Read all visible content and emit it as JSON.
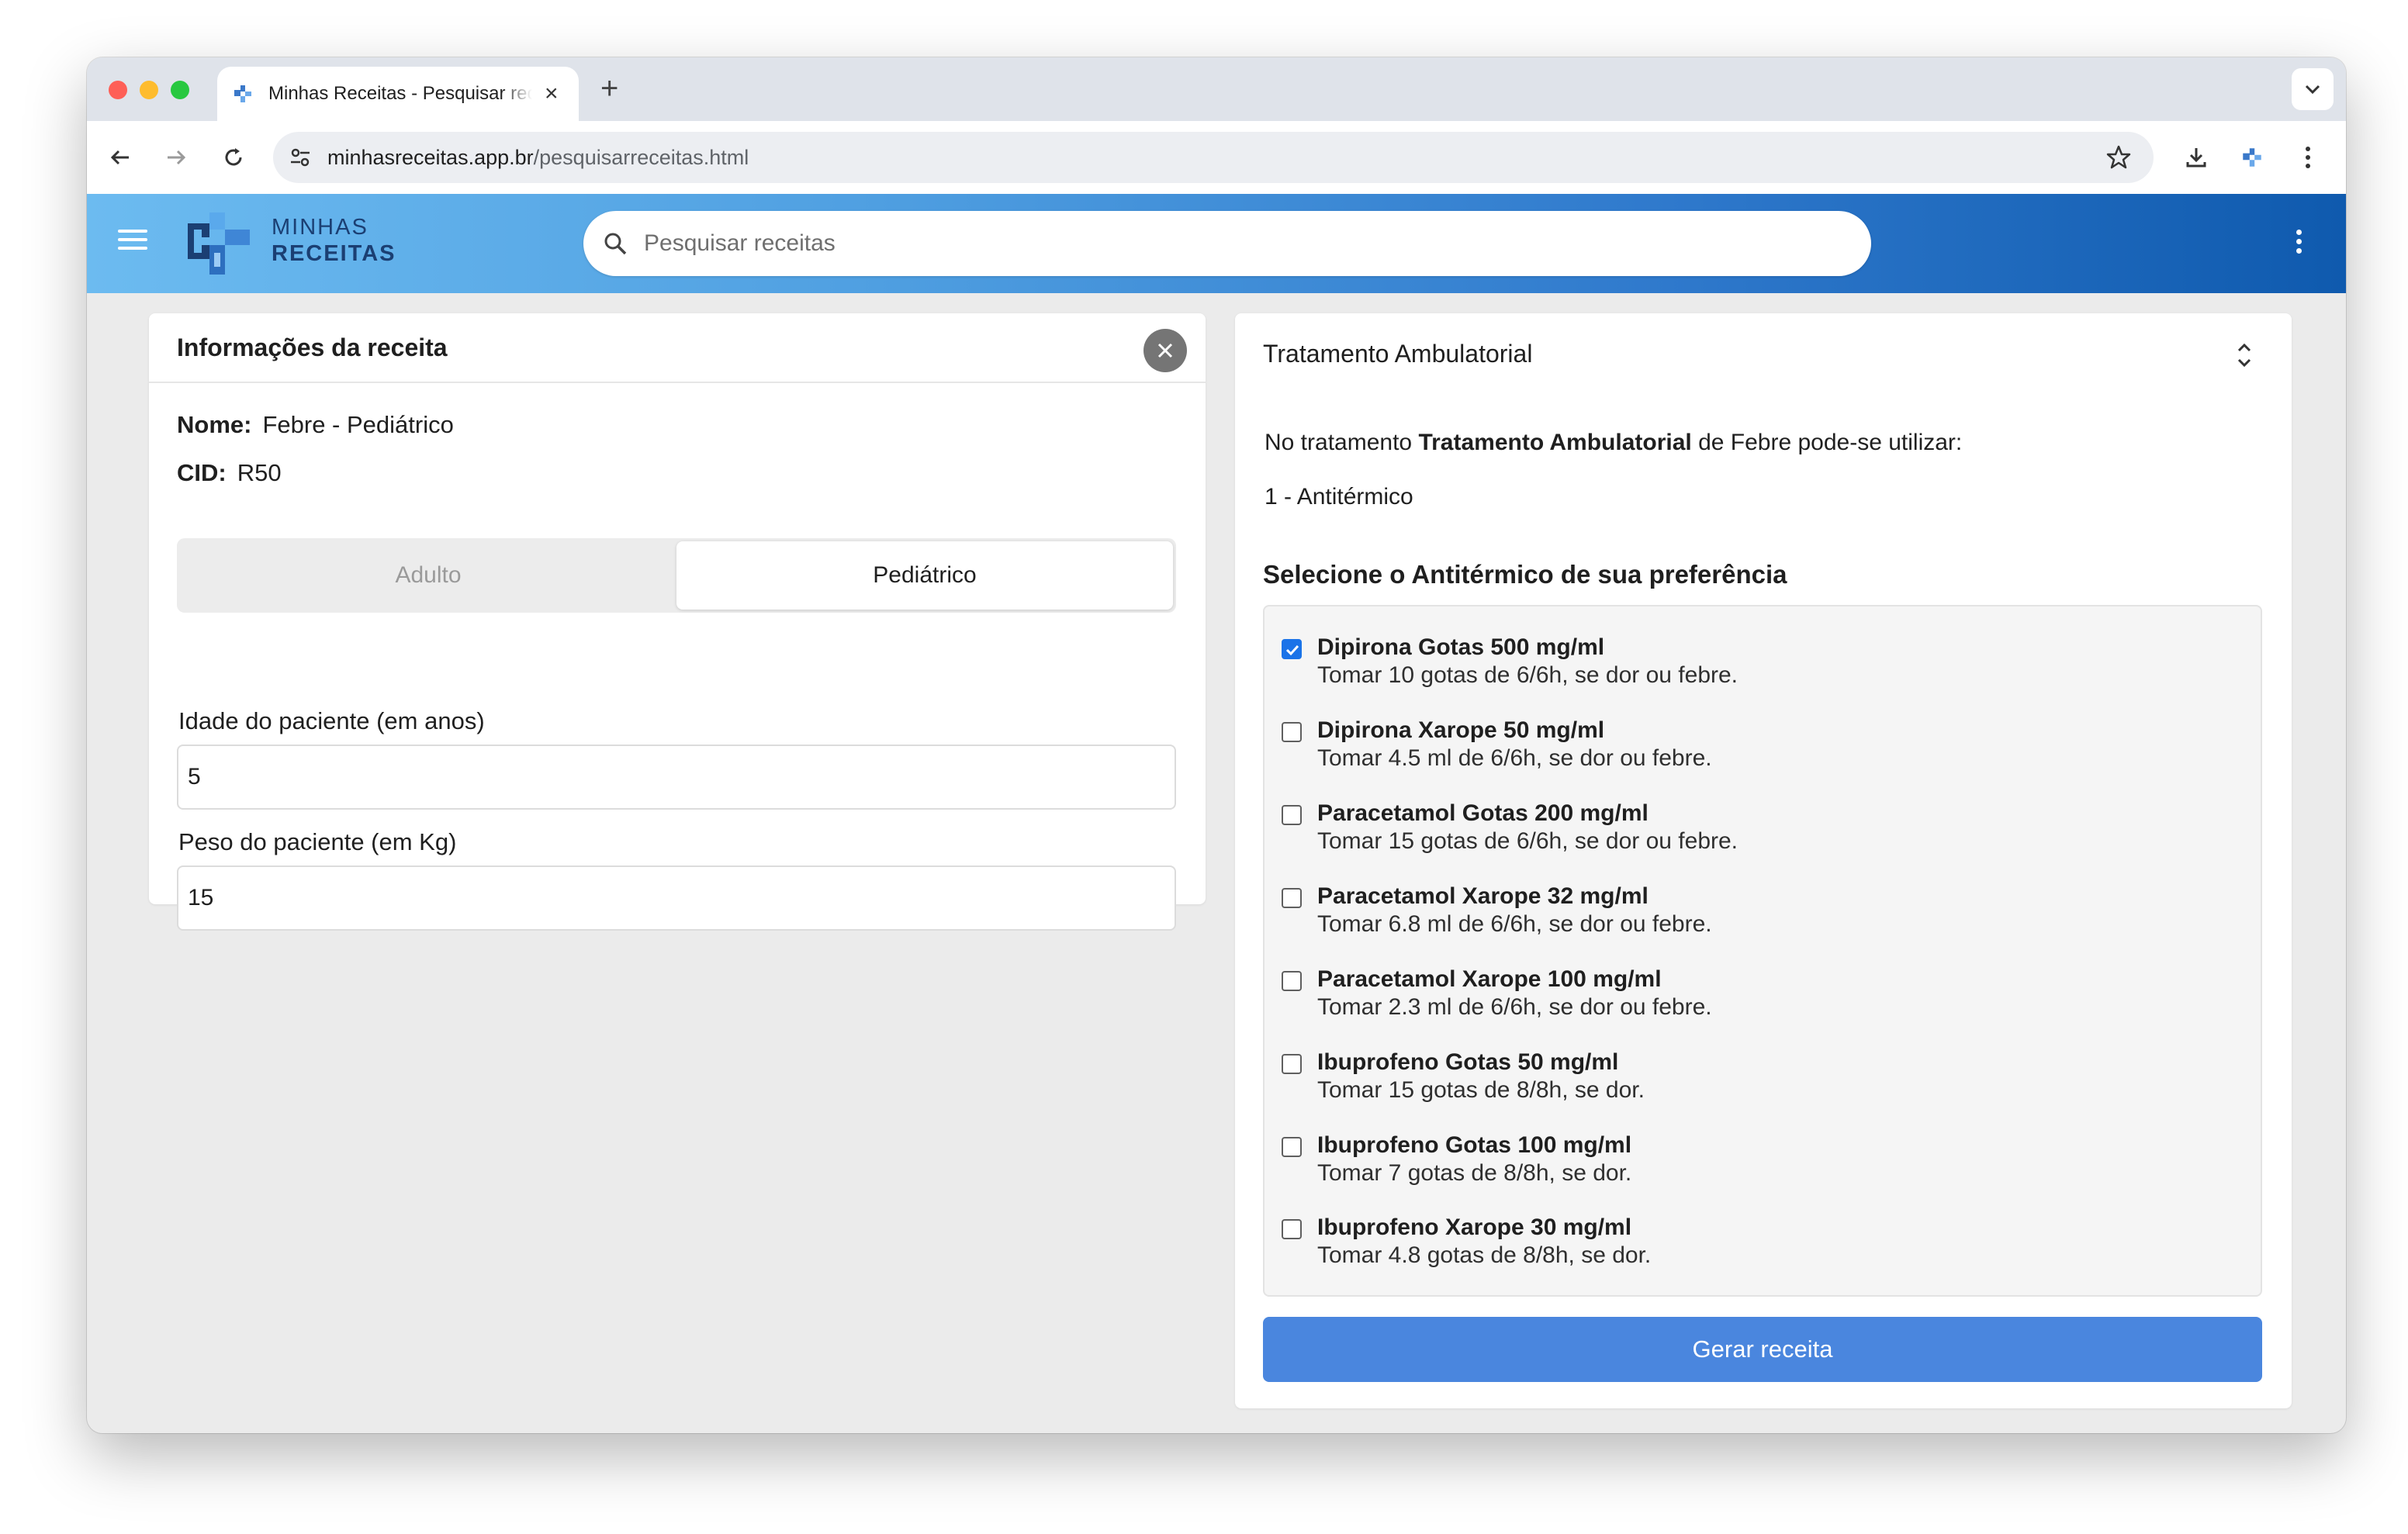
{
  "browser": {
    "tab_title": "Minhas Receitas - Pesquisar receitas",
    "url_host": "minhasreceitas.app.br",
    "url_path": "/pesquisarreceitas.html"
  },
  "header": {
    "logo_line1": "MINHAS",
    "logo_line2": "RECEITAS",
    "search_placeholder": "Pesquisar receitas"
  },
  "info_card": {
    "title": "Informações da receita",
    "name_label": "Nome:",
    "name_value": "Febre - Pediátrico",
    "cid_label": "CID:",
    "cid_value": "R50",
    "segments": {
      "adult": "Adulto",
      "pediatric": "Pediátrico",
      "selected": "Pediátrico"
    },
    "age_label": "Idade do paciente (em anos)",
    "age_value": "5",
    "weight_label": "Peso do paciente (em Kg)",
    "weight_value": "15"
  },
  "treatment_card": {
    "title": "Tratamento Ambulatorial",
    "intro_prefix": "No tratamento",
    "intro_bold": "Tratamento Ambulatorial",
    "intro_suffix": "de Febre pode-se utilizar:",
    "step": "1 - Antitérmico",
    "select_title": "Selecione o Antitérmico de sua preferência",
    "options": [
      {
        "name": "Dipirona Gotas 500 mg/ml",
        "desc": "Tomar 10 gotas de 6/6h, se dor ou febre.",
        "checked": true
      },
      {
        "name": "Dipirona Xarope 50 mg/ml",
        "desc": "Tomar 4.5 ml de 6/6h, se dor ou febre.",
        "checked": false
      },
      {
        "name": "Paracetamol Gotas 200 mg/ml",
        "desc": "Tomar 15 gotas de 6/6h, se dor ou febre.",
        "checked": false
      },
      {
        "name": "Paracetamol Xarope 32 mg/ml",
        "desc": "Tomar 6.8 ml de 6/6h, se dor ou febre.",
        "checked": false
      },
      {
        "name": "Paracetamol Xarope 100 mg/ml",
        "desc": "Tomar 2.3 ml de 6/6h, se dor ou febre.",
        "checked": false
      },
      {
        "name": "Ibuprofeno Gotas 50 mg/ml",
        "desc": "Tomar 15 gotas de 8/8h, se dor.",
        "checked": false
      },
      {
        "name": "Ibuprofeno Gotas 100 mg/ml",
        "desc": "Tomar 7 gotas de 8/8h, se dor.",
        "checked": false
      },
      {
        "name": "Ibuprofeno Xarope 30 mg/ml",
        "desc": "Tomar 4.8 gotas de 8/8h, se dor.",
        "checked": false
      }
    ],
    "button_label": "Gerar receita"
  },
  "colors": {
    "accent": "#4a86de",
    "header_start": "#6cbbf0",
    "header_end": "#0f5aae",
    "checkbox": "#1a73e8"
  }
}
